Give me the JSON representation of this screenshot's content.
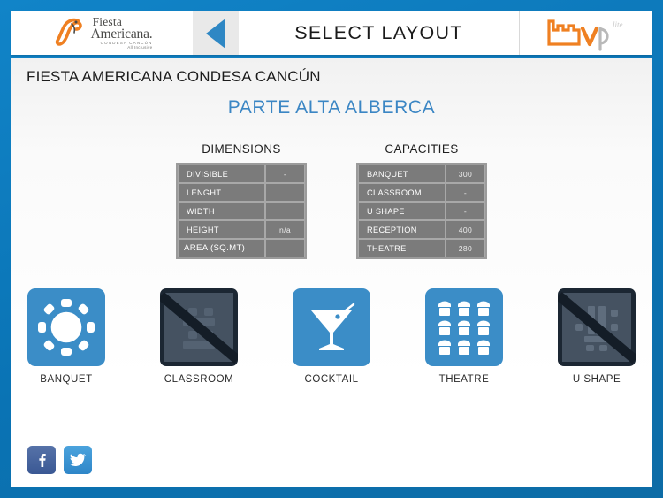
{
  "header": {
    "title": "SELECT LAYOUT",
    "back_label": "back-arrow",
    "brand_left": {
      "name_line1": "Fiesta",
      "name_line2": "Americana.",
      "sub_line1": "CONDESA CANCÚN",
      "sub_line2": "All Inclusive"
    },
    "brand_right": {
      "name": "bvp",
      "suffix": "lite"
    }
  },
  "page": {
    "hotel_name": "FIESTA AMERICANA CONDESA CANCÚN",
    "room_name": "PARTE ALTA ALBERCA"
  },
  "dimensions": {
    "heading": "DIMENSIONS",
    "rows": [
      {
        "label": "DIVISIBLE",
        "value": "-"
      },
      {
        "label": "LENGHT",
        "value": ""
      },
      {
        "label": "WIDTH",
        "value": ""
      },
      {
        "label": "HEIGHT",
        "value": "n/a"
      },
      {
        "label": "AREA (SQ.MT)",
        "value": ""
      }
    ]
  },
  "capacities": {
    "heading": "CAPACITIES",
    "rows": [
      {
        "label": "BANQUET",
        "value": "300"
      },
      {
        "label": "CLASSROOM",
        "value": "-"
      },
      {
        "label": "U SHAPE",
        "value": "-"
      },
      {
        "label": "RECEPTION",
        "value": "400"
      },
      {
        "label": "THEATRE",
        "value": "280"
      }
    ]
  },
  "layouts": [
    {
      "label": "BANQUET",
      "icon": "round-table-icon",
      "enabled": true
    },
    {
      "label": "CLASSROOM",
      "icon": "classroom-desks-icon",
      "enabled": false
    },
    {
      "label": "COCKTAIL",
      "icon": "martini-glass-icon",
      "enabled": true
    },
    {
      "label": "THEATRE",
      "icon": "chair-grid-icon",
      "enabled": true
    },
    {
      "label": "U SHAPE",
      "icon": "u-shape-table-icon",
      "enabled": false
    }
  ],
  "social": [
    {
      "label": "Facebook",
      "icon": "facebook-icon"
    },
    {
      "label": "Twitter",
      "icon": "twitter-icon"
    }
  ],
  "colors": {
    "app_background": "#0d7cc0",
    "accent_blue": "#3b86c4",
    "tile_blue": "#3b8dc7",
    "tile_disabled": "#1c2733",
    "table_cell": "#7b7b7b",
    "brand_orange": "#ef8022"
  }
}
